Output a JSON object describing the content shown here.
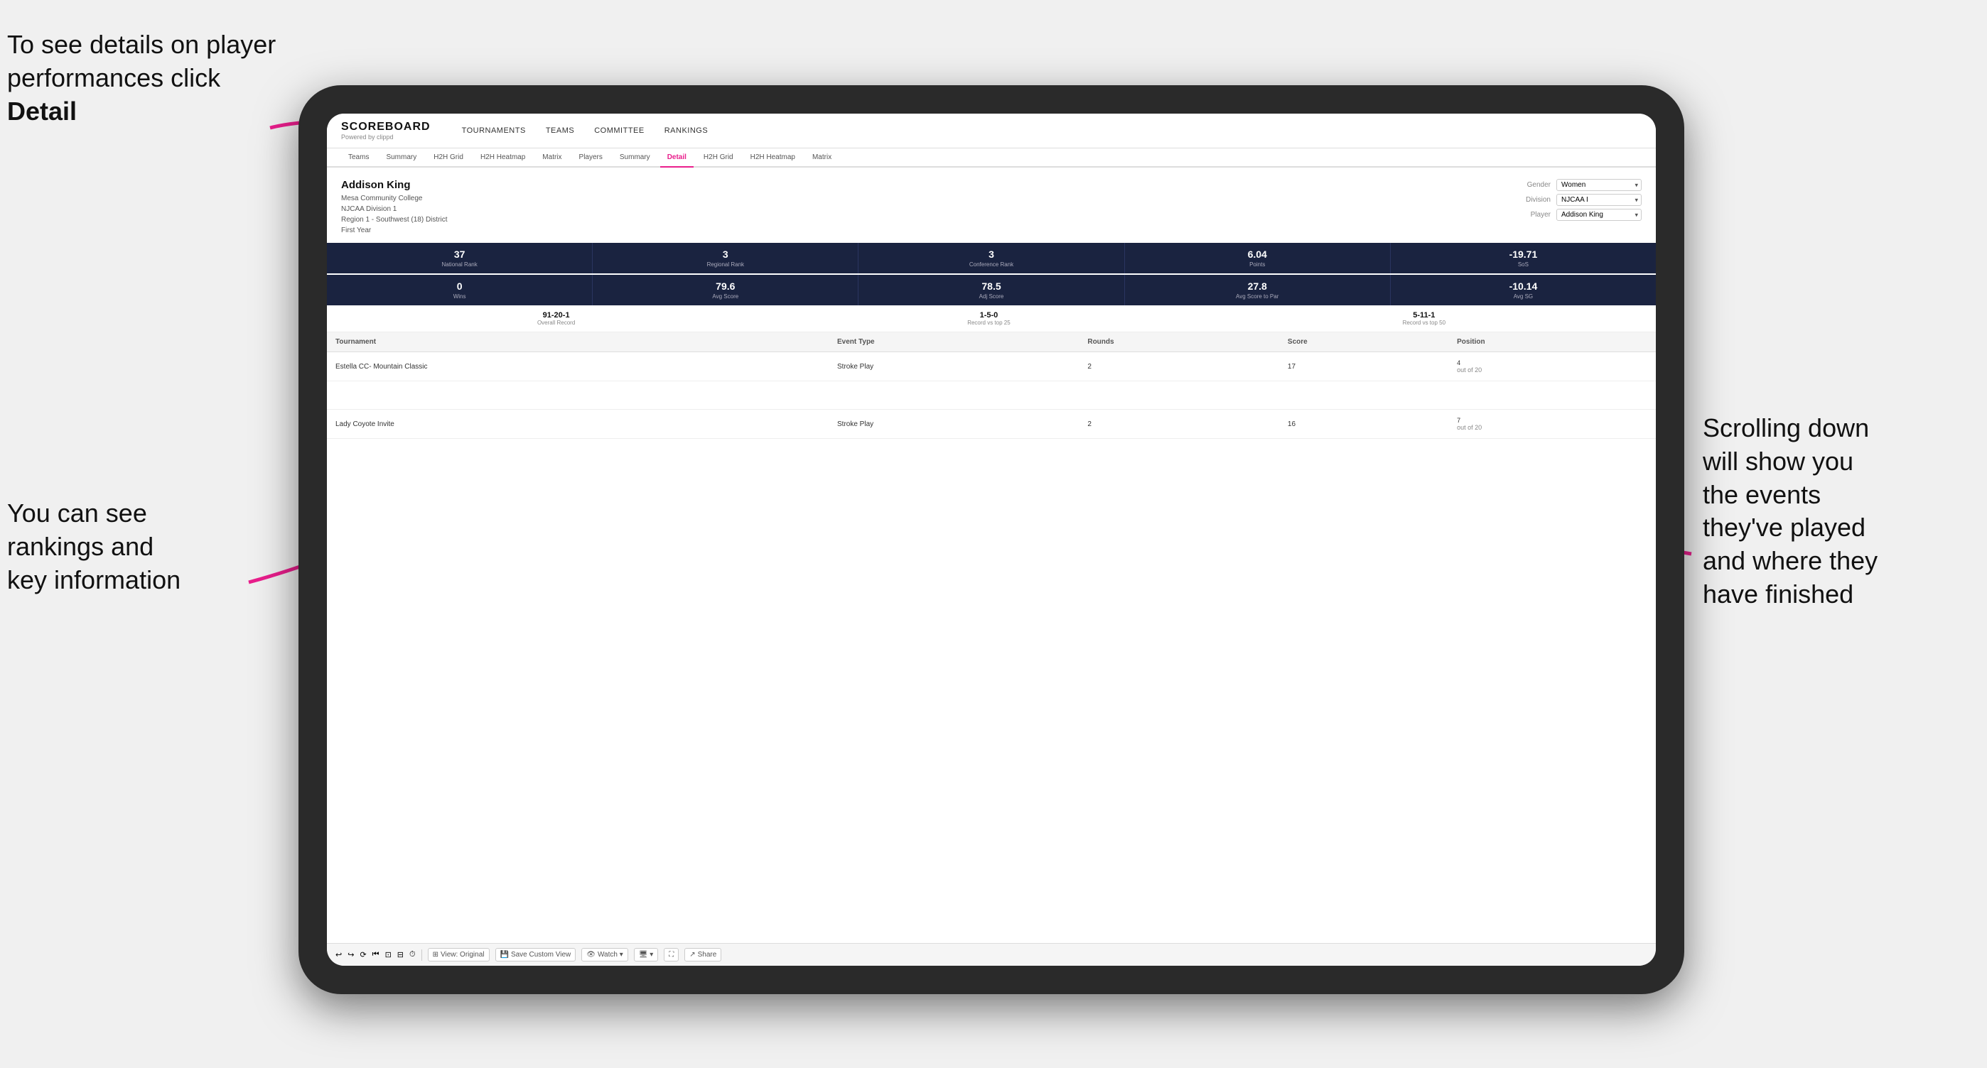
{
  "annotations": {
    "top_left": "To see details on player performances click ",
    "top_left_bold": "Detail",
    "bottom_left_line1": "You can see",
    "bottom_left_line2": "rankings and",
    "bottom_left_line3": "key information",
    "right_line1": "Scrolling down",
    "right_line2": "will show you",
    "right_line3": "the events",
    "right_line4": "they've played",
    "right_line5": "and where they",
    "right_line6": "have finished"
  },
  "nav": {
    "logo": "SCOREBOARD",
    "logo_sub": "Powered by clippd",
    "main_items": [
      "TOURNAMENTS",
      "TEAMS",
      "COMMITTEE",
      "RANKINGS"
    ],
    "sub_items": [
      "Teams",
      "Summary",
      "H2H Grid",
      "H2H Heatmap",
      "Matrix",
      "Players",
      "Summary",
      "Detail",
      "H2H Grid",
      "H2H Heatmap",
      "Matrix"
    ]
  },
  "player": {
    "name": "Addison King",
    "school": "Mesa Community College",
    "division": "NJCAA Division 1",
    "region": "Region 1 - Southwest (18) District",
    "year": "First Year",
    "gender_label": "Gender",
    "gender_value": "Women",
    "division_label": "Division",
    "division_value": "NJCAA I",
    "player_label": "Player",
    "player_value": "Addison King"
  },
  "stats_row1": [
    {
      "value": "37",
      "label": "National Rank"
    },
    {
      "value": "3",
      "label": "Regional Rank"
    },
    {
      "value": "3",
      "label": "Conference Rank"
    },
    {
      "value": "6.04",
      "label": "Points"
    },
    {
      "value": "-19.71",
      "label": "SoS"
    }
  ],
  "stats_row2": [
    {
      "value": "0",
      "label": "Wins"
    },
    {
      "value": "79.6",
      "label": "Avg Score"
    },
    {
      "value": "78.5",
      "label": "Adj Score"
    },
    {
      "value": "27.8",
      "label": "Avg Score to Par"
    },
    {
      "value": "-10.14",
      "label": "Avg SG"
    }
  ],
  "records": [
    {
      "value": "91-20-1",
      "label": "Overall Record"
    },
    {
      "value": "1-5-0",
      "label": "Record vs top 25"
    },
    {
      "value": "5-11-1",
      "label": "Record vs top 50"
    }
  ],
  "table": {
    "headers": [
      "Tournament",
      "Event Type",
      "Rounds",
      "Score",
      "Position"
    ],
    "rows": [
      {
        "tournament": "Estella CC- Mountain Classic",
        "event_type": "Stroke Play",
        "rounds": "2",
        "score": "17",
        "position": "4\nout of 20"
      },
      {
        "tournament": "",
        "event_type": "",
        "rounds": "",
        "score": "",
        "position": ""
      },
      {
        "tournament": "Lady Coyote Invite",
        "event_type": "Stroke Play",
        "rounds": "2",
        "score": "16",
        "position": "7\nout of 20"
      }
    ]
  },
  "toolbar": {
    "items": [
      "↩",
      "↪",
      "⟳",
      "⏮",
      "⊡",
      "⊟",
      "⏱",
      "View: Original",
      "Save Custom View",
      "Watch ▾",
      "🖥 ▾",
      "⛶",
      "Share"
    ]
  }
}
